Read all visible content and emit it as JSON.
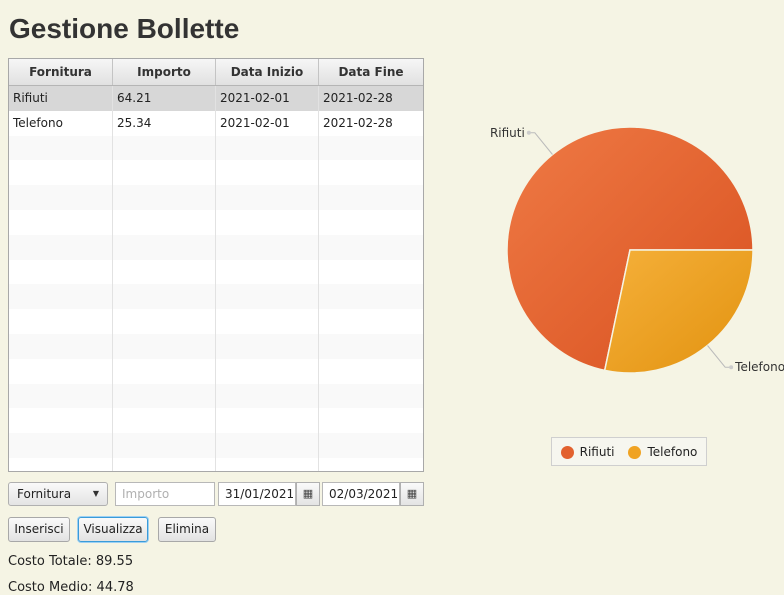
{
  "title": "Gestione Bollette",
  "table": {
    "columns": [
      "Fornitura",
      "Importo",
      "Data Inizio",
      "Data Fine"
    ],
    "rows": [
      [
        "Rifiuti",
        "64.21",
        "2021-02-01",
        "2021-02-28"
      ],
      [
        "Telefono",
        "25.34",
        "2021-02-01",
        "2021-02-28"
      ]
    ],
    "selected_row": 0,
    "empty_rows": 14
  },
  "form": {
    "fornitura_value": "Fornitura",
    "importo_placeholder": "Importo",
    "data_inizio": "31/01/2021",
    "data_fine": "02/03/2021"
  },
  "buttons": {
    "inserisci": "Inserisci",
    "visualizza": "Visualizza",
    "elimina": "Elimina"
  },
  "stats": {
    "totale_label": "Costo Totale:",
    "totale_value": "89.55",
    "medio_label": "Costo Medio:",
    "medio_value": "44.78"
  },
  "chart_data": {
    "type": "pie",
    "labels": [
      "Rifiuti",
      "Telefono"
    ],
    "values": [
      64.21,
      25.34
    ],
    "colors": [
      "#e2612f",
      "#f0a323"
    ],
    "legend": "bottom"
  }
}
